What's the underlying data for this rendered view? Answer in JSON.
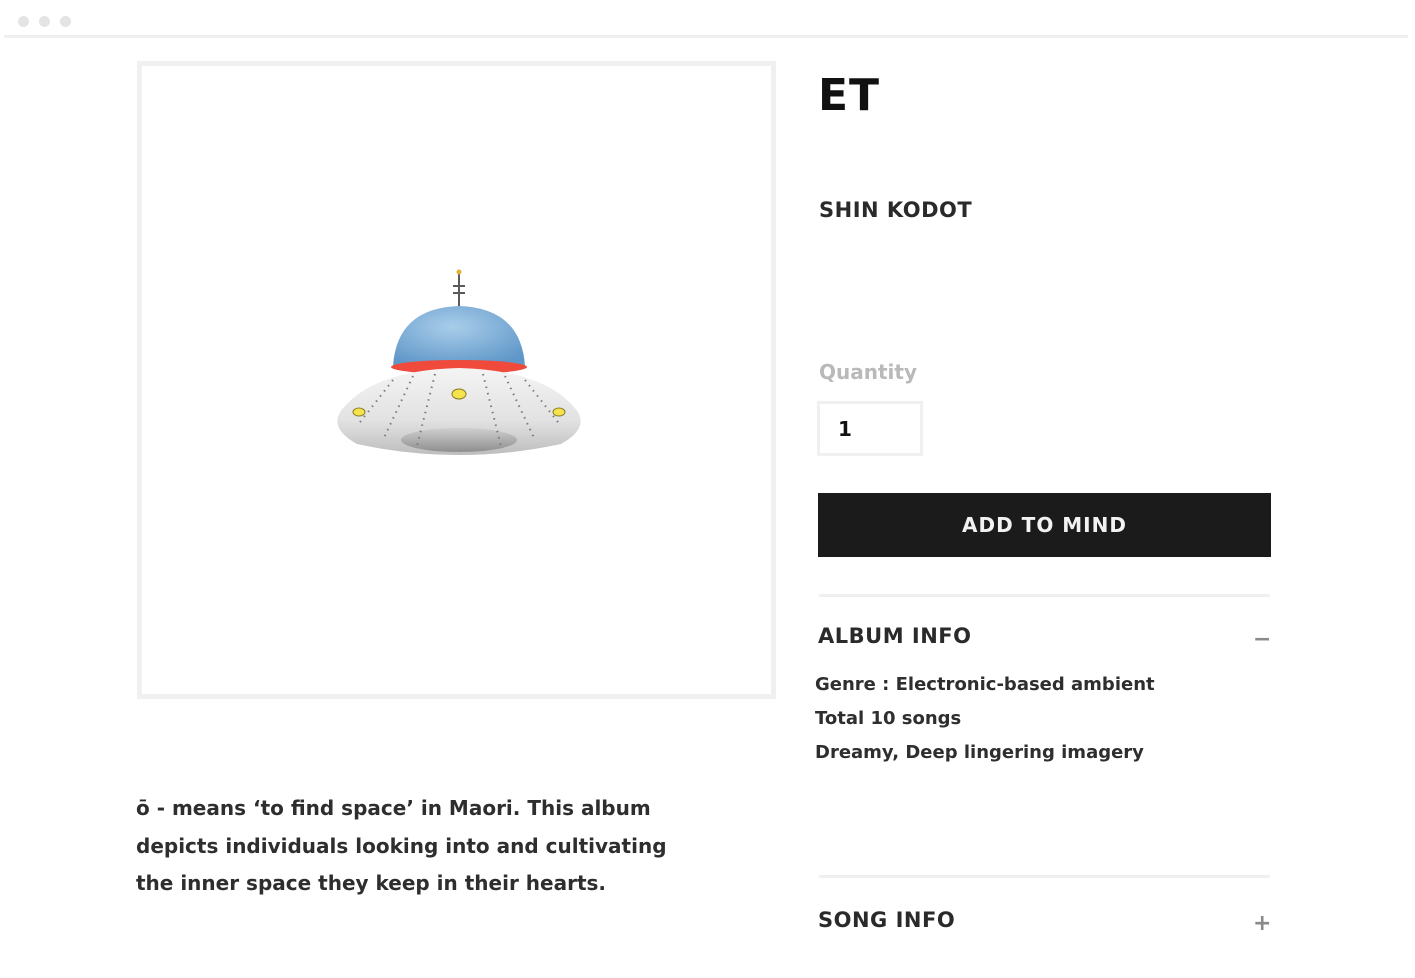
{
  "window": {
    "controls": [
      "window-dot",
      "window-dot",
      "window-dot"
    ]
  },
  "product": {
    "title": "ET",
    "artist": "SHIN KODOT",
    "image_icon": "ufo-image",
    "description_lines": [
      "ō - means ‘to find space’ in Maori. This album",
      "depicts individuals looking into and cultivating",
      "the inner space they keep in their hearts."
    ]
  },
  "purchase": {
    "quantity_label": "Quantity",
    "quantity_value": "1",
    "add_button_label": "ADD TO MIND"
  },
  "sections": {
    "album_info": {
      "title": "ALBUM INFO",
      "toggle": "−",
      "expanded": true,
      "details": [
        "Genre : Electronic-based ambient",
        "Total 10 songs",
        "Dreamy, Deep lingering imagery"
      ]
    },
    "song_info": {
      "title": "SONG INFO",
      "toggle": "+",
      "expanded": false
    }
  },
  "colors": {
    "button_bg": "#1b1b1b",
    "text": "#2a2a2a",
    "muted": "#b9b9b9",
    "border": "#f0f0f0"
  }
}
